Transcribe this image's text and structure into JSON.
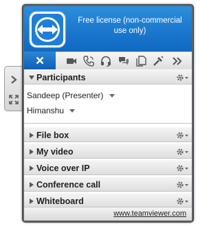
{
  "header": {
    "license_text": "Free license (non-commercial use only)"
  },
  "toolbar": {
    "icons": [
      "close-icon",
      "video-icon",
      "phone-icon",
      "headset-icon",
      "chat-icon",
      "files-icon",
      "tools-icon",
      "more-icon"
    ]
  },
  "sections": {
    "participants": {
      "title": "Participants",
      "expanded": true
    },
    "file_box": {
      "title": "File box",
      "expanded": false
    },
    "my_video": {
      "title": "My video",
      "expanded": false
    },
    "voip": {
      "title": "Voice over IP",
      "expanded": false
    },
    "conference_call": {
      "title": "Conference call",
      "expanded": false
    },
    "whiteboard": {
      "title": "Whiteboard",
      "expanded": false
    }
  },
  "participants": [
    {
      "name": "Sandeep (Presenter)"
    },
    {
      "name": "Himanshu"
    }
  ],
  "footer": {
    "link": "www.teamviewer.com"
  },
  "colors": {
    "brand_blue": "#1570c8",
    "frame_gray": "#5f6467"
  }
}
